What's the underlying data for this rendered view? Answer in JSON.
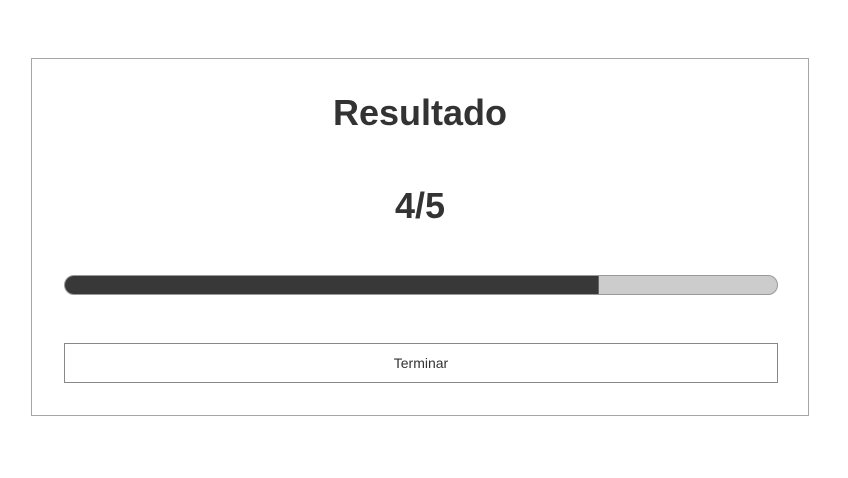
{
  "result": {
    "title": "Resultado",
    "score_text": "4/5",
    "progress_fraction": 0.75
  },
  "actions": {
    "finish_label": "Terminar"
  },
  "colors": {
    "progress_fill": "#383838",
    "progress_track": "#cccccc",
    "text": "#333333",
    "border": "#a6a6a6"
  }
}
